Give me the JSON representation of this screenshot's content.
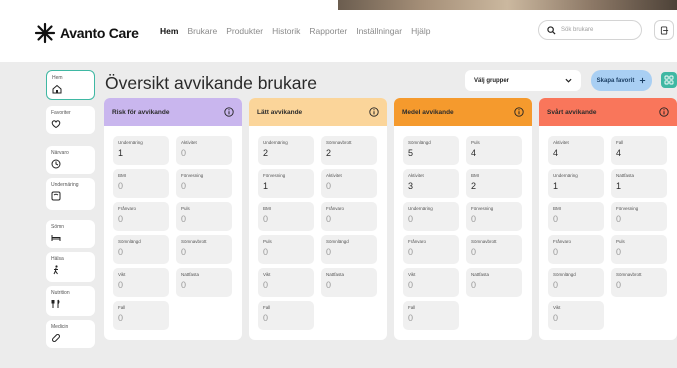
{
  "header": {
    "logo_text": "Avanto Care",
    "nav": [
      "Hem",
      "Brukare",
      "Produkter",
      "Historik",
      "Rapporter",
      "Inställningar",
      "Hjälp"
    ],
    "active_nav": "Hem",
    "search_placeholder": "Sök brukare"
  },
  "sidebar": {
    "items": [
      {
        "label": "Hem",
        "icon": "home-icon"
      },
      {
        "label": "Favoriter",
        "icon": "heart-icon"
      },
      {
        "label": "Närvaro",
        "icon": "clock-icon"
      },
      {
        "label": "Undernäring",
        "icon": "scale-icon"
      },
      {
        "label": "Sömn",
        "icon": "bed-icon"
      },
      {
        "label": "Hälsa",
        "icon": "person-walking-icon"
      },
      {
        "label": "Nutrition",
        "icon": "cutlery-icon"
      },
      {
        "label": "Medicin",
        "icon": "pill-icon"
      }
    ]
  },
  "main": {
    "title": "Översikt avvikande brukare",
    "group_select": "Välj grupper",
    "create_favorite": "Skapa favorit"
  },
  "columns": [
    {
      "title": "Risk för avvikande",
      "color": "#c9b6ee",
      "cards": [
        {
          "label": "Undernäring",
          "value": "1"
        },
        {
          "label": "Aktivitet",
          "value": "0"
        },
        {
          "label": "BMI",
          "value": "0"
        },
        {
          "label": "Förvesning",
          "value": "0"
        },
        {
          "label": "Frånvaro",
          "value": "0"
        },
        {
          "label": "Puls",
          "value": "0"
        },
        {
          "label": "Sömnlängd",
          "value": "0"
        },
        {
          "label": "Sömnavbrott",
          "value": "0"
        },
        {
          "label": "Vikt",
          "value": "0"
        },
        {
          "label": "Nattfasta",
          "value": "0"
        },
        {
          "label": "Fall",
          "value": "0"
        }
      ]
    },
    {
      "title": "Lätt avvikande",
      "color": "#fbd59a",
      "cards": [
        {
          "label": "Undernäring",
          "value": "2"
        },
        {
          "label": "Sömnavbrott",
          "value": "2"
        },
        {
          "label": "Förvesning",
          "value": "1"
        },
        {
          "label": "Aktivitet",
          "value": "0"
        },
        {
          "label": "BMI",
          "value": "0"
        },
        {
          "label": "Frånvaro",
          "value": "0"
        },
        {
          "label": "Puls",
          "value": "0"
        },
        {
          "label": "Sömnlängd",
          "value": "0"
        },
        {
          "label": "Vikt",
          "value": "0"
        },
        {
          "label": "Nattfasta",
          "value": "0"
        },
        {
          "label": "Fall",
          "value": "0"
        }
      ]
    },
    {
      "title": "Medel avvikande",
      "color": "#f59a2d",
      "cards": [
        {
          "label": "Sömnlängd",
          "value": "5"
        },
        {
          "label": "Puls",
          "value": "4"
        },
        {
          "label": "Aktivitet",
          "value": "3"
        },
        {
          "label": "BMI",
          "value": "2"
        },
        {
          "label": "Undernäring",
          "value": "0"
        },
        {
          "label": "Förvesning",
          "value": "0"
        },
        {
          "label": "Frånvaro",
          "value": "0"
        },
        {
          "label": "Sömnavbrott",
          "value": "0"
        },
        {
          "label": "Vikt",
          "value": "0"
        },
        {
          "label": "Nattfasta",
          "value": "0"
        },
        {
          "label": "Fall",
          "value": "0"
        }
      ]
    },
    {
      "title": "Svårt avvikande",
      "color": "#f9765b",
      "cards": [
        {
          "label": "Aktivitet",
          "value": "4"
        },
        {
          "label": "Fall",
          "value": "4"
        },
        {
          "label": "Undernäring",
          "value": "1"
        },
        {
          "label": "Nattfasta",
          "value": "1"
        },
        {
          "label": "BMI",
          "value": "0"
        },
        {
          "label": "Förvesning",
          "value": "0"
        },
        {
          "label": "Frånvaro",
          "value": "0"
        },
        {
          "label": "Puls",
          "value": "0"
        },
        {
          "label": "Sömnlängd",
          "value": "0"
        },
        {
          "label": "Sömnavbrott",
          "value": "0"
        },
        {
          "label": "Vikt",
          "value": "0"
        }
      ]
    }
  ]
}
